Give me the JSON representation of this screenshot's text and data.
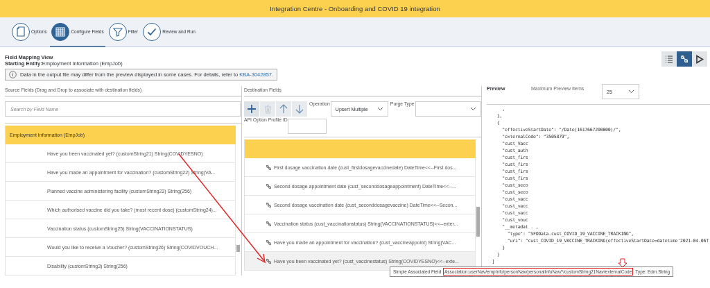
{
  "window": {
    "title": "Integration Centre - Onboarding and COVID 19 integration"
  },
  "steps": [
    {
      "label": "Options",
      "selected": false
    },
    {
      "label": "Configure Fields",
      "selected": true
    },
    {
      "label": "Filter",
      "selected": false
    },
    {
      "label": "Review and Run",
      "selected": false
    }
  ],
  "view": {
    "title": "Field Mapping View",
    "entity_label": "Starting Entity:",
    "entity": "Employment Information (EmpJob)",
    "info": "Data in the output file may differ from the preview displayed in some cases. For details, refer to ",
    "info_link": "KBA-3042857."
  },
  "view_toolbar": [
    {
      "selected": false
    },
    {
      "selected": true
    },
    {
      "selected": false
    }
  ],
  "source": {
    "heading": "Source Fields (Drag and Drop to associate with destination fields)",
    "search_placeholder": "Search by Field Name",
    "group": "Employment Information (EmpJob)",
    "rows": [
      "Have you been vaccinated yet? (customString21) String(COVIDYESNO)",
      "Have you made an appointment for vaccination? (customString22) String(VA...",
      "Planned vaccine administering facility (customString23) String(256)",
      "Which authorised vaccine did you take? (most recent dose) (customString24)...",
      "Vaccination status (customString25) String(VACCINATIONSTATUS)",
      "Would you like to receive a Voucher? (customString26) String(COVIDVOUCH...",
      "Disability (customString3) String(256)"
    ]
  },
  "destination": {
    "heading": "Destination Fields",
    "tools": [
      {
        "disabled": false
      },
      {
        "disabled": true
      },
      {
        "disabled": false
      },
      {
        "disabled": false
      }
    ],
    "operation_label": "Operation",
    "operation": "Upsert Multiple",
    "purge_label": "Purge Type",
    "api_label": "API Option Profile ID",
    "rows": [
      {
        "text": "First dosage vaccination date (cust_firstdosagevaccinedate) DateTime<<--First dos...",
        "selected": false
      },
      {
        "text": "Second dosage appointment date (cust_seconddosageappointment) DateTime<<--...",
        "selected": false
      },
      {
        "text": "Second dosage vaccination date (cust_seconddosagevaccine) DateTime<<--Secon...",
        "selected": false
      },
      {
        "text": "Vaccination status (cust_vaccinationstatus) String(VACCINATIONSTATUS)<<--exter...",
        "selected": false
      },
      {
        "text": "Have you made an appointment for vaccination? (cust_vaccineappoint) String(VAC...",
        "selected": false
      },
      {
        "text": "Have you been vaccinated yet? (cust_vaccinestatus) String(COVIDYESNO)<<--exte...",
        "selected": true
      }
    ]
  },
  "preview": {
    "heading": "Preview",
    "max_label": "Maximum Preview Items",
    "max_value": "25",
    "lines": [
      "      ,",
      "    },",
      "    {",
      "      \"effectiveStartDate\": \"/Date(1617667200000)/\",",
      "      \"externalCode\": \"3505879\",",
      "      \"cust_Vacc",
      "      \"cust_auth",
      "      \"cust_firs",
      "      \"cust_firs",
      "      \"cust_firs",
      "      \"cust_firs",
      "      \"cust_seco",
      "      \"cust_seco",
      "      \"cust_vacc",
      "      \"cust_vacc",
      "      \"cust_vacc",
      "      \"cust_vouc",
      "      \"__metadat . ,",
      "        \"type\": \"SFOData.cust_COVID_19_VACCINE_TRACKING\",",
      "        \"uri\": \"cust_COVID_19_VACCINE_TRACKING(effectiveStartDate=datetime'2021-04-06T",
      "      }",
      "    }",
      "  ]"
    ]
  },
  "tooltip": [
    {
      "text": "Simple Associated Field",
      "highlighted": false
    },
    {
      "text": "Association:userNav/empInfo/personNav/personalInfoNav/*/customString21Nav/externalCode",
      "highlighted": true
    },
    {
      "text": "Type: Edm.String",
      "highlighted": false
    }
  ]
}
